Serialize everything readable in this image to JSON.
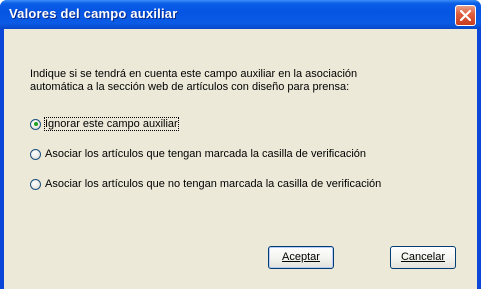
{
  "dialog": {
    "title": "Valores del campo auxiliar",
    "description_line1": "Indique si se tendrá en cuenta este campo auxiliar en la asociación",
    "description_line2": "automática a la sección web de artículos con diseño para prensa:",
    "options": [
      {
        "label": "Ignorar este campo auxiliar",
        "selected": true
      },
      {
        "label": "Asociar los artículos que tengan marcada la casilla de verificación",
        "selected": false
      },
      {
        "label": "Asociar los artículos que no tengan marcada la casilla de verificación",
        "selected": false
      }
    ],
    "accept_label": "Aceptar",
    "cancel_label": "Cancelar"
  },
  "colors": {
    "titlebar": "#0554e3",
    "client": "#ece9d8",
    "close": "#e0603f",
    "radio_dot": "#21a121"
  },
  "icons": {
    "close": "close-icon"
  }
}
